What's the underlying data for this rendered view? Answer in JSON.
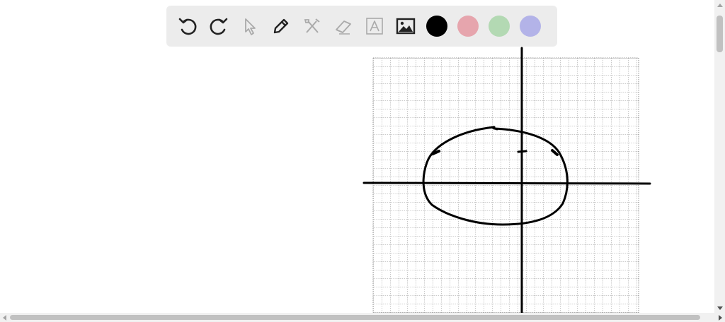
{
  "toolbar": {
    "tools": [
      {
        "name": "undo-icon",
        "enabled": true
      },
      {
        "name": "redo-icon",
        "enabled": true
      },
      {
        "name": "select-arrow-icon",
        "enabled": false
      },
      {
        "name": "pen-icon",
        "enabled": true
      },
      {
        "name": "tools-crossed-icon",
        "enabled": false
      },
      {
        "name": "eraser-icon",
        "enabled": false
      },
      {
        "name": "text-box-icon",
        "enabled": false
      },
      {
        "name": "image-icon",
        "enabled": true
      }
    ],
    "colors": [
      {
        "name": "black",
        "hex": "#000000",
        "selected": true
      },
      {
        "name": "red",
        "hex": "#e6a5ad"
      },
      {
        "name": "green",
        "hex": "#b3d9b3"
      },
      {
        "name": "blue",
        "hex": "#b3b3e8"
      }
    ]
  }
}
